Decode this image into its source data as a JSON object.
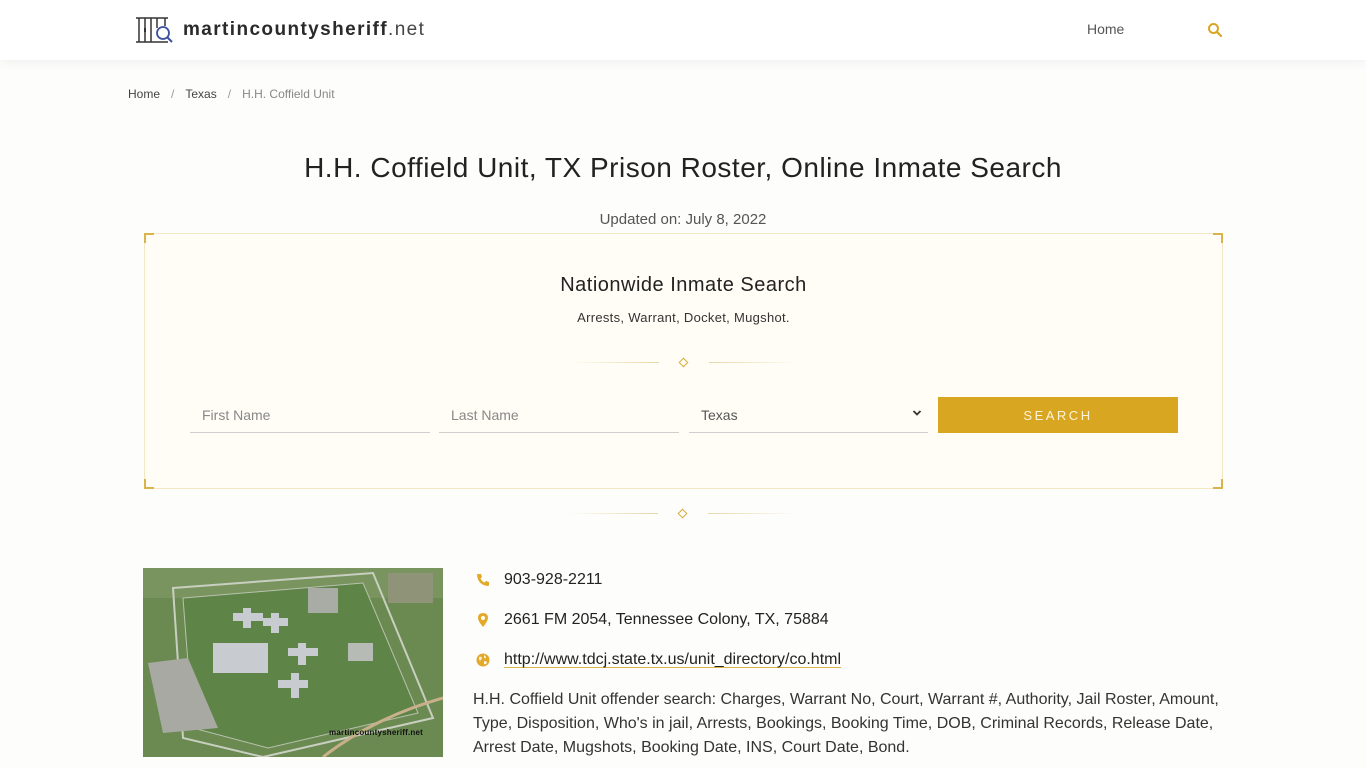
{
  "header": {
    "logo_name": "martincountysheriff",
    "logo_tld": ".net",
    "nav": [
      {
        "label": "Home"
      }
    ],
    "search_icon": "search-icon"
  },
  "breadcrumb": [
    {
      "label": "Home"
    },
    {
      "label": "Texas"
    },
    {
      "label": "H.H. Coffield Unit"
    }
  ],
  "page": {
    "title": "H.H. Coffield Unit, TX Prison Roster, Online Inmate Search",
    "updated": "Updated on: July 8, 2022"
  },
  "search": {
    "title": "Nationwide Inmate Search",
    "subtitle": "Arrests, Warrant, Docket, Mugshot.",
    "first_name_placeholder": "First Name",
    "last_name_placeholder": "Last Name",
    "state_selected": "Texas",
    "button_label": "SEARCH"
  },
  "facility": {
    "photo_watermark": "martincountysheriff.net",
    "phone": "903-928-2211",
    "address": "2661 FM 2054, Tennessee Colony, TX, 75884",
    "website": "http://www.tdcj.state.tx.us/unit_directory/co.html",
    "description": "H.H. Coffield Unit offender search: Charges, Warrant No, Court, Warrant #, Authority, Jail Roster, Amount, Type, Disposition, Who's in jail, Arrests, Bookings, Booking Time, DOB, Criminal Records, Release Date, Arrest Date, Mugshots, Booking Date, INS, Court Date, Bond."
  },
  "colors": {
    "accent": "#d9a622",
    "box_bg": "#fffdf5"
  }
}
